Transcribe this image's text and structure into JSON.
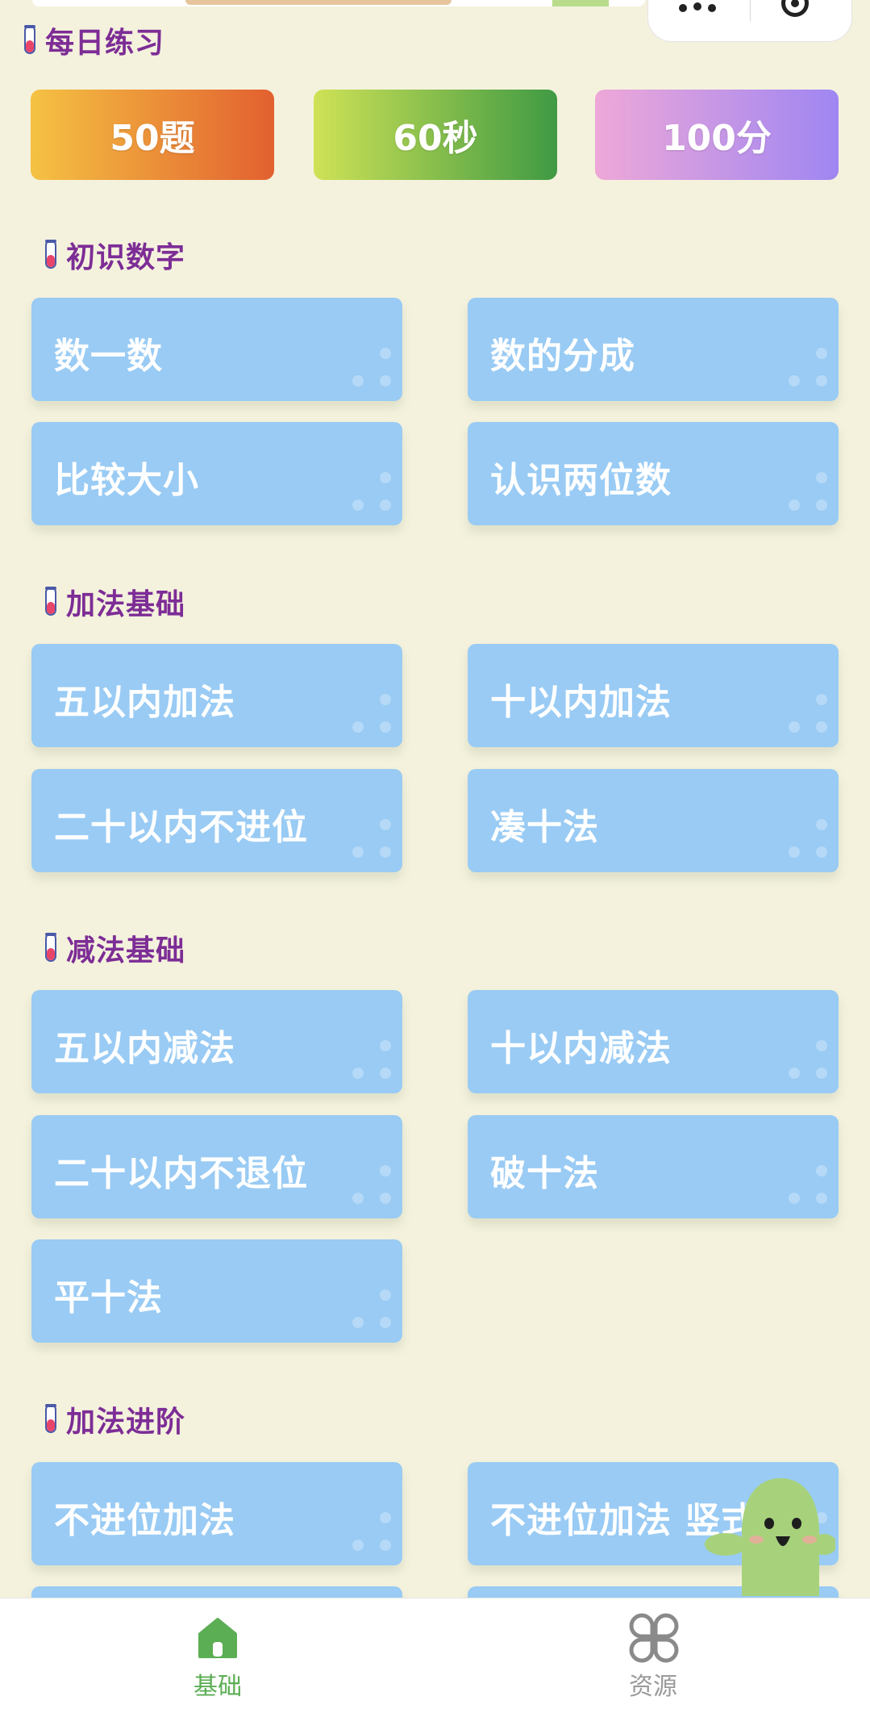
{
  "daily": {
    "title": "每日练习",
    "stats": [
      {
        "label": "50题"
      },
      {
        "label": "60秒"
      },
      {
        "label": "100分"
      }
    ]
  },
  "sections": [
    {
      "title": "初识数字",
      "items": [
        "数一数",
        "数的分成",
        "比较大小",
        "认识两位数"
      ]
    },
    {
      "title": "加法基础",
      "items": [
        "五以内加法",
        "十以内加法",
        "二十以内不进位",
        "凑十法"
      ]
    },
    {
      "title": "减法基础",
      "items": [
        "五以内减法",
        "十以内减法",
        "二十以内不退位",
        "破十法",
        "平十法"
      ]
    },
    {
      "title": "加法进阶",
      "items": [
        "不进位加法",
        "不进位加法 竖式"
      ]
    }
  ],
  "tabbar": {
    "tabs": [
      {
        "label": "基础",
        "icon": "home-icon",
        "active": true
      },
      {
        "label": "资源",
        "icon": "clover-grid-icon",
        "active": false
      }
    ]
  },
  "colors": {
    "background": "#f4f2dd",
    "section_title": "#7d2d96",
    "tile": "#99cbf4",
    "tab_active": "#5cae54",
    "tab_inactive": "#9a9a9a"
  }
}
